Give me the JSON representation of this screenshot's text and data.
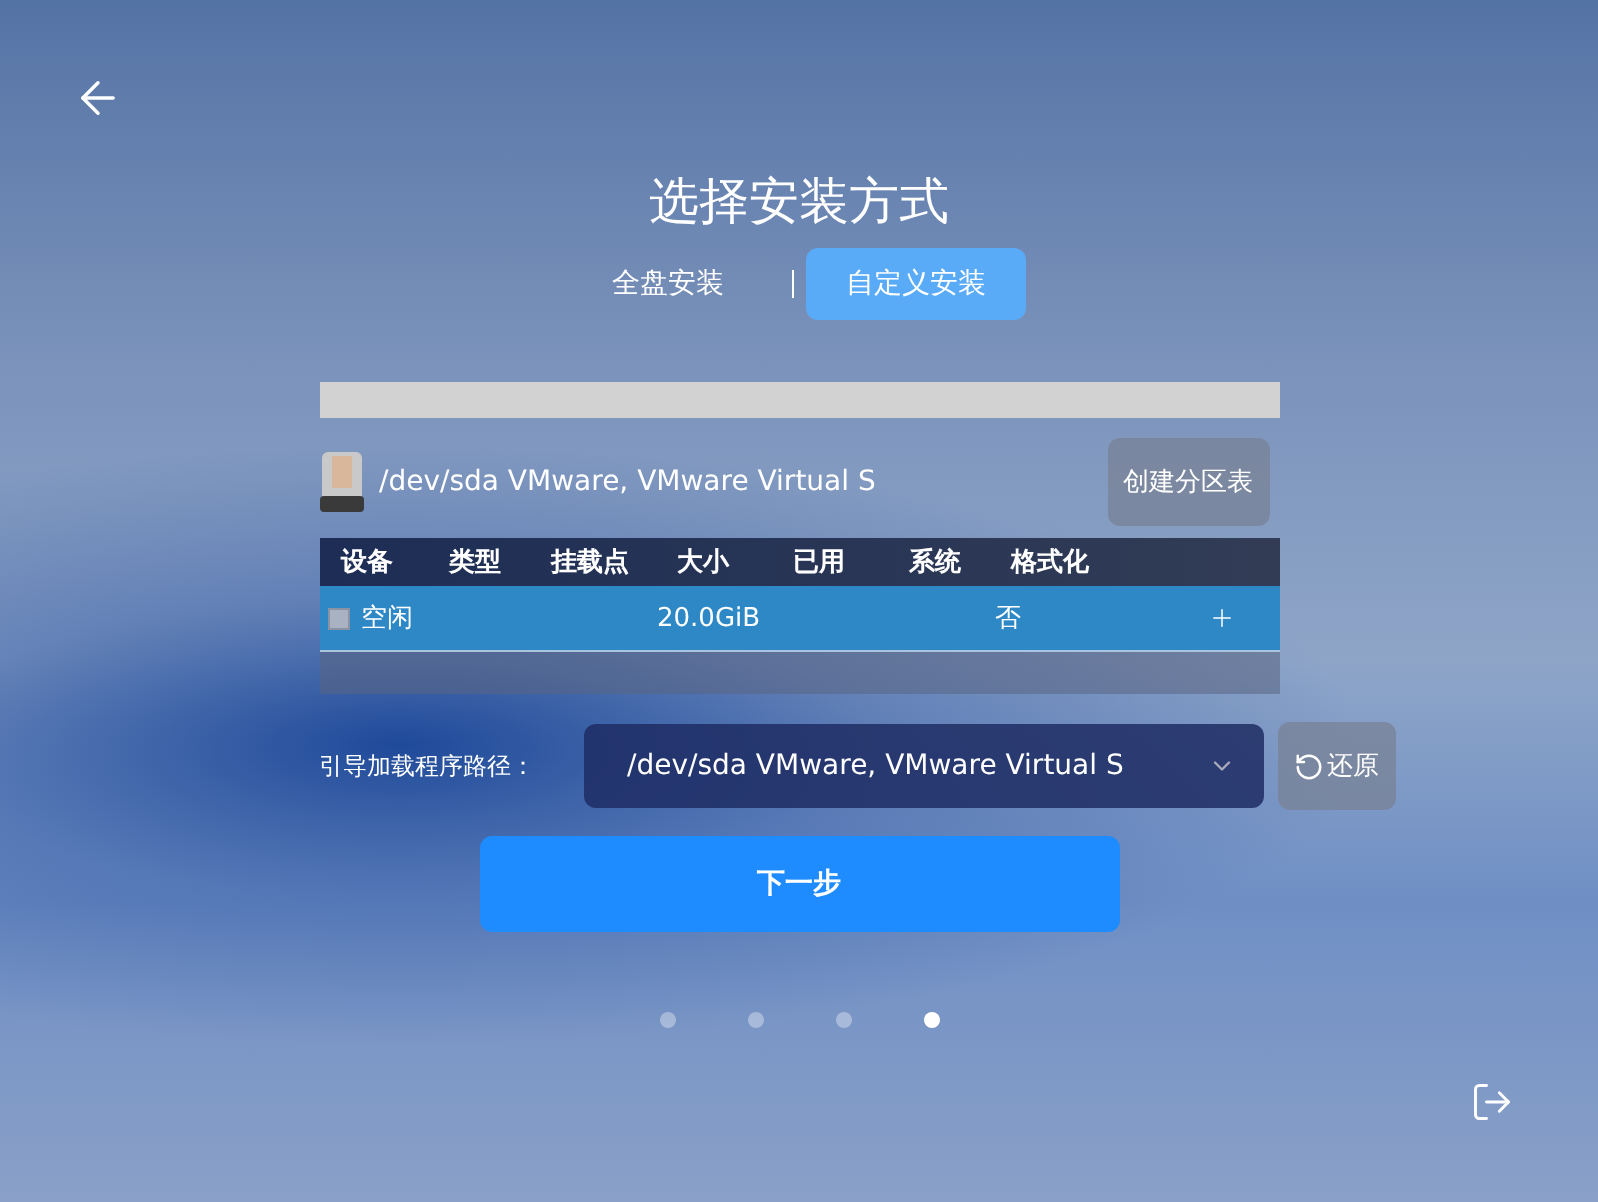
{
  "title": "选择安装方式",
  "tabs": [
    {
      "label": "全盘安装",
      "selected": false
    },
    {
      "label": "自定义安装",
      "selected": true
    }
  ],
  "disk": {
    "name": "/dev/sda VMware, VMware Virtual S",
    "create_button": "创建分区表"
  },
  "table": {
    "columns": [
      "设备",
      "类型",
      "挂载点",
      "大小",
      "已用",
      "系统",
      "格式化"
    ],
    "rows": [
      {
        "device": "空闲",
        "size": "20.0GiB",
        "format": "否",
        "selected": true
      }
    ]
  },
  "boot": {
    "label": "引导加载程序路径：",
    "value": "/dev/sda VMware, VMware Virtual S",
    "restore_button": "还原"
  },
  "next_button": "下一步",
  "pages": [
    {
      "selected": false
    },
    {
      "selected": false
    },
    {
      "selected": false
    },
    {
      "selected": true
    }
  ]
}
